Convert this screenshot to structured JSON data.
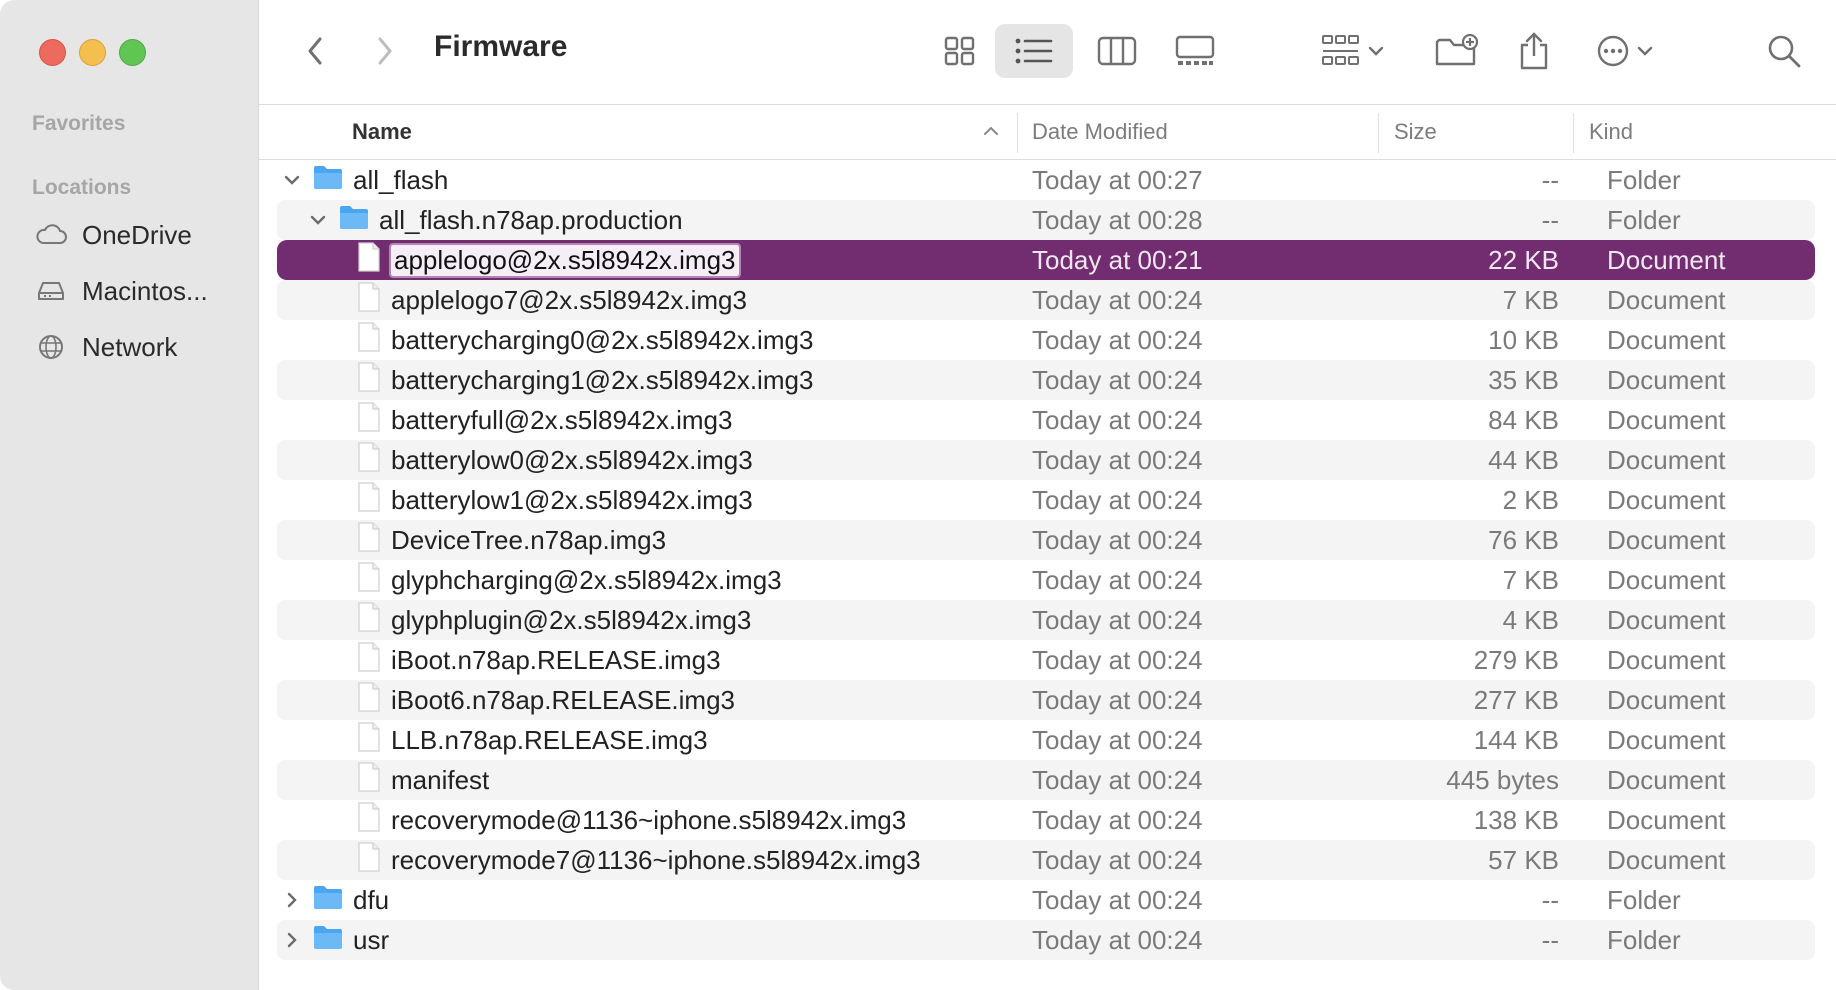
{
  "window": {
    "title": "Firmware"
  },
  "sidebar": {
    "favorites_label": "Favorites",
    "locations_label": "Locations",
    "locations": [
      {
        "label": "OneDrive",
        "icon": "cloud-icon"
      },
      {
        "label": "Macintos...",
        "icon": "drive-icon"
      },
      {
        "label": "Network",
        "icon": "globe-icon"
      }
    ]
  },
  "toolbar": {
    "title": "Firmware",
    "view_modes": [
      "icon-view",
      "list-view",
      "column-view",
      "gallery-view"
    ],
    "active_view": "list-view"
  },
  "columns": {
    "name": "Name",
    "date": "Date Modified",
    "size": "Size",
    "kind": "Kind"
  },
  "rows": [
    {
      "name": "all_flash",
      "date": "Today at 00:27",
      "size": "--",
      "kind": "Folder"
    },
    {
      "name": "all_flash.n78ap.production",
      "date": "Today at 00:28",
      "size": "--",
      "kind": "Folder"
    },
    {
      "name": "applelogo@2x.s5l8942x.img3",
      "date": "Today at 00:21",
      "size": "22 KB",
      "kind": "Document"
    },
    {
      "name": "applelogo7@2x.s5l8942x.img3",
      "date": "Today at 00:24",
      "size": "7 KB",
      "kind": "Document"
    },
    {
      "name": "batterycharging0@2x.s5l8942x.img3",
      "date": "Today at 00:24",
      "size": "10 KB",
      "kind": "Document"
    },
    {
      "name": "batterycharging1@2x.s5l8942x.img3",
      "date": "Today at 00:24",
      "size": "35 KB",
      "kind": "Document"
    },
    {
      "name": "batteryfull@2x.s5l8942x.img3",
      "date": "Today at 00:24",
      "size": "84 KB",
      "kind": "Document"
    },
    {
      "name": "batterylow0@2x.s5l8942x.img3",
      "date": "Today at 00:24",
      "size": "44 KB",
      "kind": "Document"
    },
    {
      "name": "batterylow1@2x.s5l8942x.img3",
      "date": "Today at 00:24",
      "size": "2 KB",
      "kind": "Document"
    },
    {
      "name": "DeviceTree.n78ap.img3",
      "date": "Today at 00:24",
      "size": "76 KB",
      "kind": "Document"
    },
    {
      "name": "glyphcharging@2x.s5l8942x.img3",
      "date": "Today at 00:24",
      "size": "7 KB",
      "kind": "Document"
    },
    {
      "name": "glyphplugin@2x.s5l8942x.img3",
      "date": "Today at 00:24",
      "size": "4 KB",
      "kind": "Document"
    },
    {
      "name": "iBoot.n78ap.RELEASE.img3",
      "date": "Today at 00:24",
      "size": "279 KB",
      "kind": "Document"
    },
    {
      "name": "iBoot6.n78ap.RELEASE.img3",
      "date": "Today at 00:24",
      "size": "277 KB",
      "kind": "Document"
    },
    {
      "name": "LLB.n78ap.RELEASE.img3",
      "date": "Today at 00:24",
      "size": "144 KB",
      "kind": "Document"
    },
    {
      "name": "manifest",
      "date": "Today at 00:24",
      "size": "445 bytes",
      "kind": "Document"
    },
    {
      "name": "recoverymode@1136~iphone.s5l8942x.img3",
      "date": "Today at 00:24",
      "size": "138 KB",
      "kind": "Document"
    },
    {
      "name": "recoverymode7@1136~iphone.s5l8942x.img3",
      "date": "Today at 00:24",
      "size": "57 KB",
      "kind": "Document"
    },
    {
      "name": "dfu",
      "date": "Today at 00:24",
      "size": "--",
      "kind": "Folder"
    },
    {
      "name": "usr",
      "date": "Today at 00:24",
      "size": "--",
      "kind": "Folder"
    }
  ],
  "selected_row": 2,
  "colors": {
    "selection": "#722d71",
    "folder": "#5aaef2",
    "sidebar": "#e7e6e6"
  }
}
